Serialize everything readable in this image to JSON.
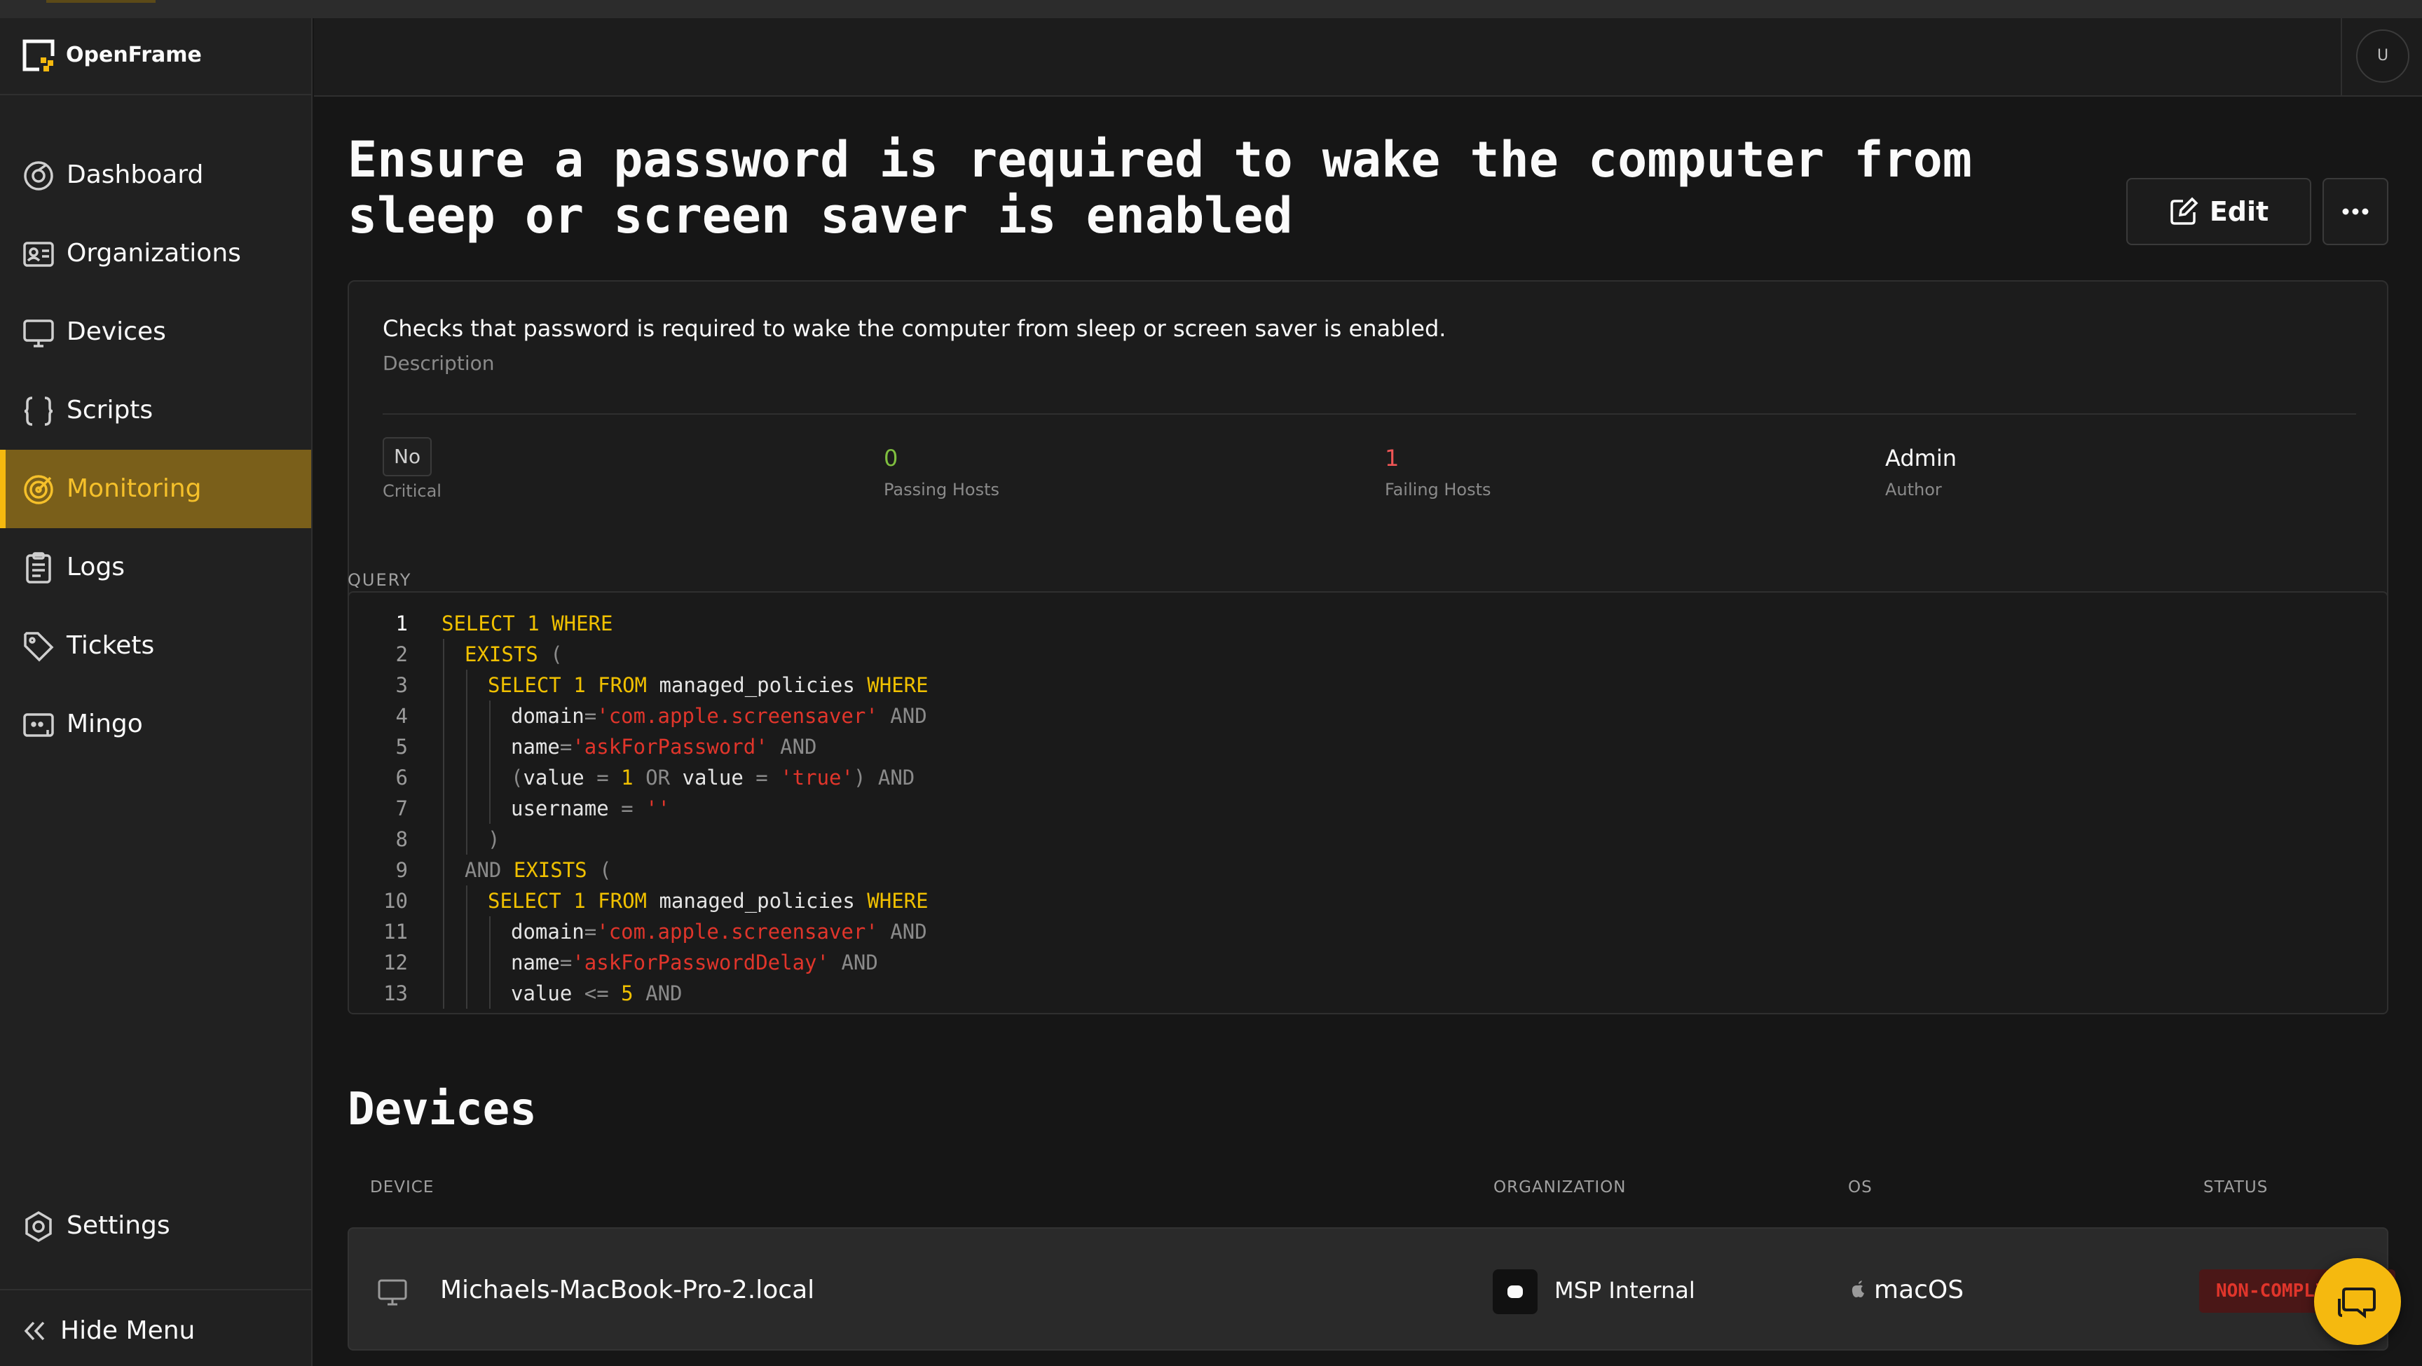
{
  "app": {
    "name": "OpenFrame"
  },
  "colors": {
    "accent": "#f5b90f",
    "active_bg": "#7a5f1a",
    "danger": "#e0352b",
    "passing": "#7fbf3f",
    "failing": "#ee5555"
  },
  "sidebar": {
    "items": [
      {
        "label": "Dashboard",
        "icon": "dashboard-icon"
      },
      {
        "label": "Organizations",
        "icon": "organizations-icon"
      },
      {
        "label": "Devices",
        "icon": "monitor-icon"
      },
      {
        "label": "Scripts",
        "icon": "braces-icon"
      },
      {
        "label": "Monitoring",
        "icon": "target-icon",
        "active": true
      },
      {
        "label": "Logs",
        "icon": "clipboard-icon"
      },
      {
        "label": "Tickets",
        "icon": "tag-icon"
      },
      {
        "label": "Mingo",
        "icon": "chat-bot-icon"
      }
    ],
    "settings_label": "Settings",
    "hide_menu_label": "Hide Menu"
  },
  "user": {
    "avatar_initial": "U"
  },
  "policy": {
    "title": "Ensure a password is required to wake the computer from sleep or screen saver is enabled",
    "edit_label": "Edit",
    "description": "Checks that password is required to wake the computer from sleep or screen saver is enabled.",
    "description_label": "Description",
    "stats": {
      "critical_value": "No",
      "critical_label": "Critical",
      "passing_value": "0",
      "passing_label": "Passing Hosts",
      "failing_value": "1",
      "failing_label": "Failing Hosts",
      "author_value": "Admin",
      "author_label": "Author"
    }
  },
  "query": {
    "label": "QUERY",
    "lines": [
      "SELECT 1 WHERE",
      "EXISTS (",
      "SELECT 1 FROM managed_policies WHERE",
      "domain='com.apple.screensaver' AND",
      "name='askForPassword' AND",
      "(value = 1 OR value = 'true') AND",
      "username = ''",
      ")",
      "AND EXISTS (",
      "SELECT 1 FROM managed_policies WHERE",
      "domain='com.apple.screensaver' AND",
      "name='askForPasswordDelay' AND",
      "value <= 5 AND"
    ]
  },
  "devices": {
    "title": "Devices",
    "columns": [
      "DEVICE",
      "ORGANIZATION",
      "OS",
      "STATUS"
    ],
    "rows": [
      {
        "device": "Michaels-MacBook-Pro-2.local",
        "organization": "MSP Internal",
        "os": "macOS",
        "status": "NON-COMPLIANT"
      }
    ]
  }
}
